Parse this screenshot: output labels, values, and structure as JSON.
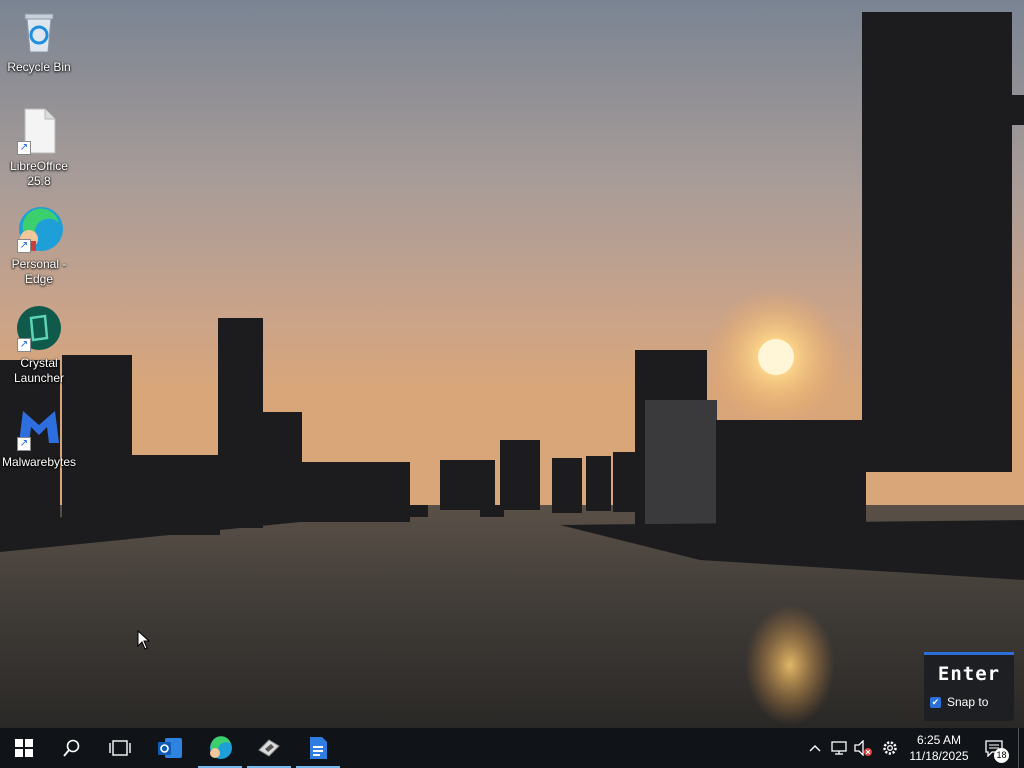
{
  "desktop": {
    "icons": [
      {
        "label": "Recycle Bin",
        "icon": "recycle-bin-icon"
      },
      {
        "label": "LibreOffice 25.8",
        "icon": "libreoffice-icon"
      },
      {
        "label": "Personal - Edge",
        "icon": "edge-profile-icon"
      },
      {
        "label": "Crystal Launcher",
        "icon": "crystal-launcher-icon"
      },
      {
        "label": "Malwarebytes",
        "icon": "malwarebytes-icon"
      }
    ]
  },
  "snap_popup": {
    "title": "Enter",
    "checkbox_label": "Snap to",
    "checked": true
  },
  "taskbar": {
    "pinned": [
      {
        "name": "start",
        "icon": "windows-start-icon"
      },
      {
        "name": "search",
        "icon": "search-icon"
      },
      {
        "name": "task-view",
        "icon": "task-view-icon"
      },
      {
        "name": "outlook",
        "icon": "outlook-icon"
      },
      {
        "name": "edge",
        "icon": "edge-icon",
        "active": true
      },
      {
        "name": "app",
        "icon": "launcher-app-icon",
        "active": true
      },
      {
        "name": "docs",
        "icon": "document-app-icon",
        "active": true
      }
    ],
    "clock": {
      "time": "6:25 AM",
      "date": "11/18/2025"
    },
    "notifications": {
      "count": "18"
    },
    "colors": {
      "taskbar": "#101418",
      "accent": "#76b9ed"
    }
  }
}
